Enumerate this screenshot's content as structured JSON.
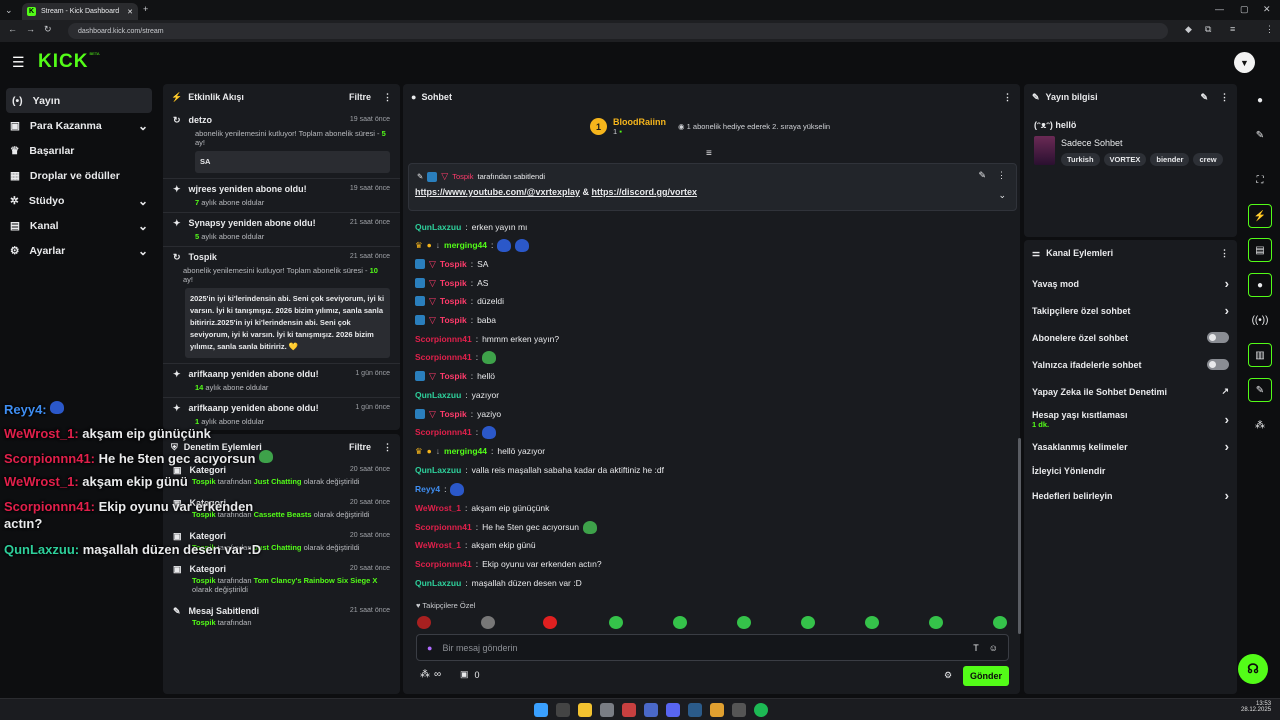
{
  "browser": {
    "tab_title": "Stream - Kick Dashboard",
    "url": "dashboard.kick.com/stream"
  },
  "brand": {
    "logo": "KICK",
    "beta": "BETA",
    "accent": "#53fc18"
  },
  "sidebar": {
    "items": [
      {
        "label": "Yayın"
      },
      {
        "label": "Para Kazanma"
      },
      {
        "label": "Başarılar"
      },
      {
        "label": "Droplar ve ödüller"
      },
      {
        "label": "Stüdyo"
      },
      {
        "label": "Kanal"
      },
      {
        "label": "Ayarlar"
      }
    ]
  },
  "activity": {
    "title": "Etkinlik Akışı",
    "filter": "Filtre",
    "items": [
      {
        "name": "detzo",
        "time": "19 saat önce",
        "sub_pre": "abonelik yenilemesini kutluyor! Toplam abonelik süresi - ",
        "sub_num": "5",
        "sub_post": " ay!",
        "box": "SA"
      },
      {
        "name": "wjrees yeniden abone oldu!",
        "time": "19 saat önce",
        "num": "7",
        "sub": " aylık abone oldular"
      },
      {
        "name": "Synapsy yeniden abone oldu!",
        "time": "21 saat önce",
        "num": "5",
        "sub": " aylık abone oldular"
      },
      {
        "name": "Tospik",
        "time": "21 saat önce",
        "sub_pre": "abonelik yenilemesini kutluyor! Toplam abonelik süresi - ",
        "sub_num": "10",
        "sub_post": " ay!",
        "box": "2025'in iyi ki'lerindensin abi. Seni çok seviyorum, iyi ki varsın. İyi ki tanışmışız. 2026 bizim yılımız, sanla sanla bitiririz.2025'in iyi ki'lerindensin abi. Seni çok seviyorum, iyi ki varsın. İyi ki tanışmışız. 2026 bizim yılımız, sanla sanla bitiririz. 💛"
      },
      {
        "name": "arifkaanp yeniden abone oldu!",
        "time": "1 gün önce",
        "num": "14",
        "sub": " aylık abone oldular"
      },
      {
        "name": "arifkaanp yeniden abone oldu!",
        "time": "1 gün önce",
        "num": "1",
        "sub": " aylık abone oldular"
      }
    ]
  },
  "moderation": {
    "title": "Denetim Eylemleri",
    "filter": "Filtre",
    "items": [
      {
        "title": "Kategori",
        "time": "20 saat önce",
        "user": "Tospik",
        "mid": " tarafından ",
        "target": "Just Chatting",
        "post": " olarak değiştirildi"
      },
      {
        "title": "Kategori",
        "time": "20 saat önce",
        "user": "Tospik",
        "mid": " tarafından ",
        "target": "Cassette Beasts",
        "post": " olarak değiştirildi"
      },
      {
        "title": "Kategori",
        "time": "20 saat önce",
        "user": "Tospik",
        "mid": " tarafından ",
        "target": "Just Chatting",
        "post": " olarak değiştirildi"
      },
      {
        "title": "Kategori",
        "time": "20 saat önce",
        "user": "Tospik",
        "mid": " tarafından ",
        "target": "Tom Clancy's Rainbow Six Siege X",
        "post": " olarak değiştirildi"
      },
      {
        "title": "Mesaj Sabitlendi",
        "time": "21 saat önce",
        "user": "Tospik",
        "mid": " tarafından",
        "target": "",
        "post": ""
      }
    ]
  },
  "chat": {
    "title": "Sohbet",
    "gifter": {
      "rank": "1",
      "name": "BloodRaiinn",
      "count": "1",
      "text": "1 abonelik hediye ederek 2. sıraya yükselin"
    },
    "pinned": {
      "by": "Tospik",
      "by_suffix": " tarafından sabitlendi",
      "link1": "https://www.youtube.com/@vxrtexplay",
      "amp": " & ",
      "link2": "https://discord.gg/vortex"
    },
    "messages": [
      {
        "user": "QunLaxzuu",
        "text": "erken yayın mı"
      },
      {
        "user": "merging44",
        "text": ""
      },
      {
        "user": "Tospik",
        "text": "SA"
      },
      {
        "user": "Tospik",
        "text": "AS"
      },
      {
        "user": "Tospik",
        "text": "düzeldi"
      },
      {
        "user": "Tospik",
        "text": "baba"
      },
      {
        "user": "Scorpionnn41",
        "text": "hmmm erken yayın?"
      },
      {
        "user": "Scorpionnn41",
        "text": ""
      },
      {
        "user": "Tospik",
        "text": "hellö"
      },
      {
        "user": "QunLaxzuu",
        "text": "yazıyor"
      },
      {
        "user": "Tospik",
        "text": "yaziyo"
      },
      {
        "user": "Scorpionnn41",
        "text": ""
      },
      {
        "user": "merging44",
        "text": "hellö yazıyor"
      },
      {
        "user": "QunLaxzuu",
        "text": "valla reis maşallah sabaha kadar da aktiftiniz he :df"
      },
      {
        "user": "Reyy4",
        "text": ""
      },
      {
        "user": "WeWrost_1",
        "text": "akşam eip günüçünk"
      },
      {
        "user": "Scorpionnn41",
        "text": "He he 5ten gec acıyorsun"
      },
      {
        "user": "WeWrost_1",
        "text": "akşam ekip günü"
      },
      {
        "user": "Scorpionnn41",
        "text": "Ekip oyunu var erkenden actın?"
      },
      {
        "user": "QunLaxzuu",
        "text": "maşallah düzen desen var :D"
      }
    ],
    "followers_only": "Takipçilere Özel",
    "input_placeholder": "Bir mesaj gönderin",
    "loop_label": "∞",
    "gift_count": "0",
    "send": "Gönder"
  },
  "stream_info": {
    "title": "Yayın bilgisi",
    "stream_title": "(ᵔᴥᵔ) hellö",
    "category": "Sadece Sohbet",
    "tags": [
      "Turkish",
      "VORTEX",
      "biender",
      "crew"
    ]
  },
  "channel_actions": {
    "title": "Kanal Eylemleri",
    "items": [
      {
        "label": "Yavaş mod"
      },
      {
        "label": "Takipçilere özel sohbet"
      },
      {
        "label": "Abonelere özel sohbet"
      },
      {
        "label": "Yalnızca ifadelerle sohbet"
      },
      {
        "label": "Yapay Zeka ile Sohbet Denetimi"
      },
      {
        "label": "Hesap yaşı kısıtlaması",
        "sub": "1 dk."
      },
      {
        "label": "Yasaklanmış kelimeler"
      },
      {
        "label": "İzleyici Yönlendir"
      },
      {
        "label": "Hedefleri belirleyin"
      }
    ]
  },
  "overlay": [
    {
      "user": "Reyy4:",
      "text": ""
    },
    {
      "user": "WeWrost_1:",
      "text": "akşam eip günüçünk"
    },
    {
      "user": "Scorpionnn41:",
      "text": "He he 5ten gec acıyorsun"
    },
    {
      "user": "WeWrost_1:",
      "text": "akşam ekip günü"
    },
    {
      "user": "Scorpionnn41:",
      "text": "Ekip oyunu var erkenden"
    },
    {
      "user": "",
      "text": "actın?"
    },
    {
      "user": "QunLaxzuu:",
      "text": "maşallah düzen desen var :D"
    }
  ],
  "taskbar": {
    "time": "13:53",
    "date": "28.12.2025"
  }
}
